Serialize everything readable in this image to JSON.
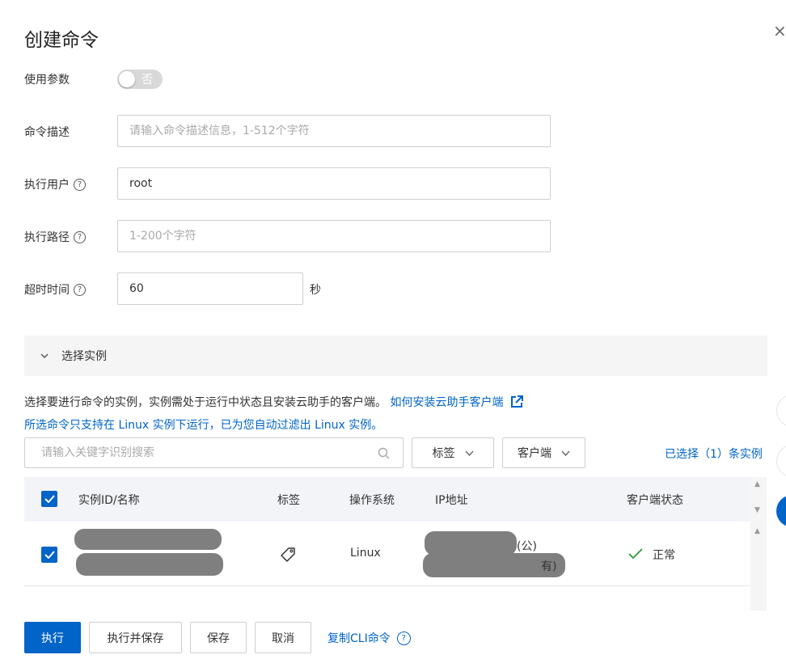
{
  "dialog": {
    "title": "创建命令",
    "close_glyph": "×"
  },
  "form": {
    "use_params": {
      "label": "使用参数",
      "toggle_text": "否"
    },
    "description": {
      "label": "命令描述",
      "placeholder": "请输入命令描述信息，1-512个字符",
      "value": ""
    },
    "user": {
      "label": "执行用户",
      "value": "root"
    },
    "path": {
      "label": "执行路径",
      "placeholder": "1-200个字符",
      "value": ""
    },
    "timeout": {
      "label": "超时时间",
      "value": "60",
      "unit": "秒"
    },
    "help_glyph": "?"
  },
  "section": {
    "label": "选择实例",
    "expanded": true
  },
  "instances": {
    "desc": "选择要进行命令的实例，实例需处于运行中状态且安装云助手的客户端。",
    "install_link": "如何安装云助手客户端",
    "notice": "所选命令只支持在 Linux 实例下运行，已为您自动过滤出 Linux 实例。",
    "search_placeholder": "请输入关键字识别搜索",
    "filter_tag": "标签",
    "filter_client": "客户端",
    "selected_count": "已选择（1）条实例",
    "columns": [
      "实例ID/名称",
      "标签",
      "操作系统",
      "IP地址",
      "客户端状态"
    ],
    "rows": [
      {
        "os": "Linux",
        "ip_public_suffix": "(公)",
        "ip_private_suffix": "有)",
        "status": "正常",
        "checked": true
      }
    ]
  },
  "footer": {
    "run": "执行",
    "run_save": "执行并保存",
    "save": "保存",
    "cancel": "取消",
    "copy_cli": "复制CLI命令",
    "help_glyph": "?"
  },
  "colors": {
    "primary": "#0064c8",
    "success": "#2e9a3a",
    "redacted": "#7f7f7f"
  }
}
